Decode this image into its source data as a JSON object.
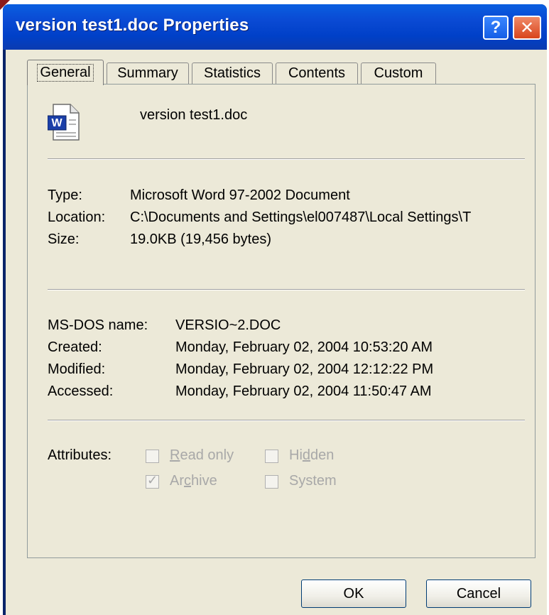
{
  "window": {
    "title": "version test1.doc Properties",
    "help_glyph": "?",
    "close_glyph": "✕"
  },
  "tabs": [
    {
      "label": "General",
      "active": true
    },
    {
      "label": "Summary"
    },
    {
      "label": "Statistics"
    },
    {
      "label": "Contents"
    },
    {
      "label": "Custom"
    }
  ],
  "general": {
    "file_icon": "word-document-icon",
    "file_name": "version test1.doc",
    "type_label": "Type:",
    "type_value": "Microsoft Word 97-2002 Document",
    "location_label": "Location:",
    "location_value": "C:\\Documents and Settings\\el007487\\Local Settings\\T",
    "size_label": "Size:",
    "size_value": "19.0KB (19,456 bytes)",
    "msdos_label": "MS-DOS name:",
    "msdos_value": "VERSIO~2.DOC",
    "created_label": "Created:",
    "created_value": "Monday, February 02, 2004 10:53:20 AM",
    "modified_label": "Modified:",
    "modified_value": "Monday, February 02, 2004 12:12:22 PM",
    "accessed_label": "Accessed:",
    "accessed_value": "Monday, February 02, 2004 11:50:47 AM",
    "attributes_label": "Attributes:",
    "attributes": {
      "read_only": {
        "label_pre": "",
        "label_u": "R",
        "label_post": "ead only",
        "checked": false
      },
      "hidden": {
        "label_pre": "Hi",
        "label_u": "d",
        "label_post": "den",
        "checked": false
      },
      "archive": {
        "label_pre": "Ar",
        "label_u": "c",
        "label_post": "hive",
        "checked": true
      },
      "system": {
        "label_pre": "",
        "label_u": "",
        "label_post": "System",
        "checked": false
      }
    }
  },
  "buttons": {
    "ok": "OK",
    "cancel": "Cancel"
  },
  "colors": {
    "title_bar": "#0a4ad4",
    "dialog_bg": "#ece9d8",
    "close_button": "#d8441c",
    "disabled_text": "#a8a8a8"
  }
}
